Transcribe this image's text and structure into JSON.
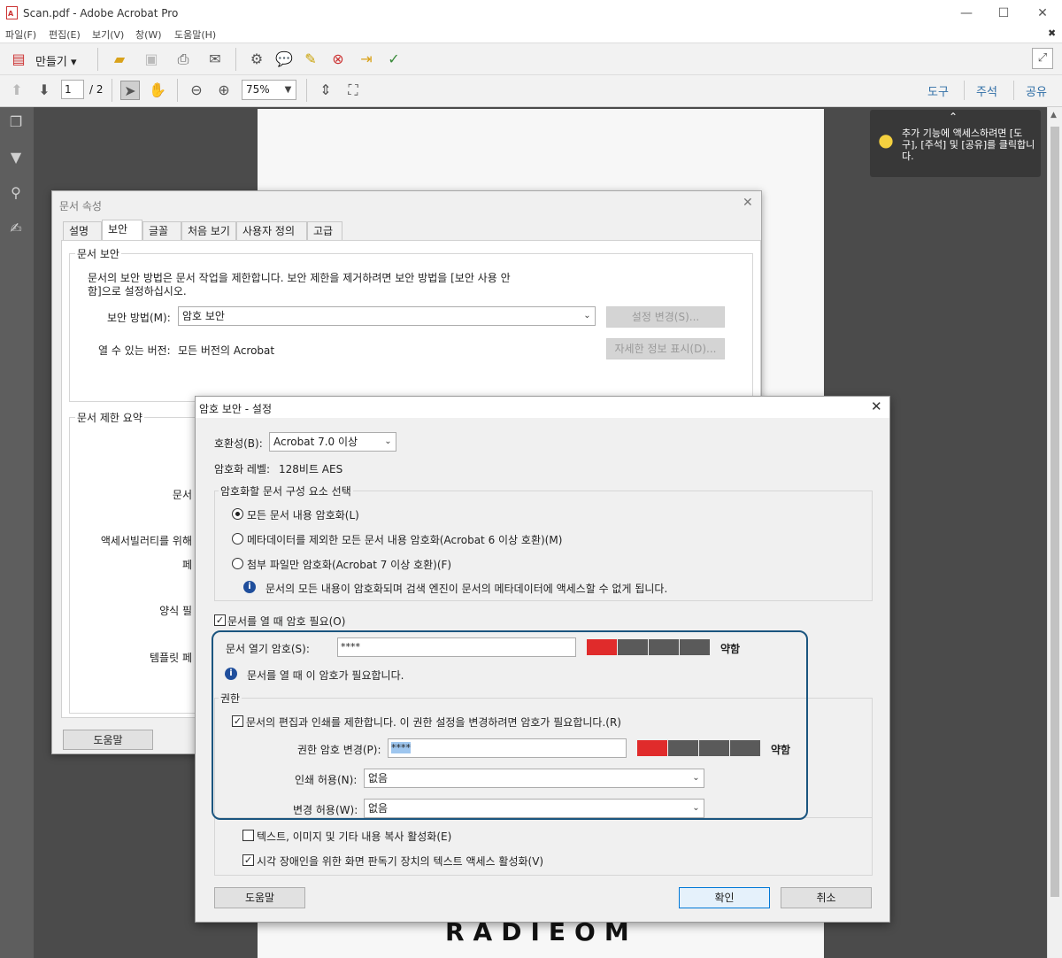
{
  "window": {
    "title": "Scan.pdf - Adobe Acrobat Pro",
    "minimize": "—",
    "maximize": "☐",
    "close": "✕"
  },
  "menu": [
    "파일(F)",
    "편집(E)",
    "보기(V)",
    "창(W)",
    "도움말(H)"
  ],
  "toolbar": {
    "create_label": "만들기 ▾"
  },
  "nav": {
    "page_current": "1",
    "page_total": "/ 2",
    "zoom": "75%"
  },
  "right_links": [
    "도구",
    "주석",
    "공유"
  ],
  "tooltip": {
    "text": "추가 기능에 액세스하려면 [도구], [주석] 및 [공유]를 클릭합니다."
  },
  "props": {
    "title": "문서 속성",
    "tabs": [
      "설명",
      "보안",
      "글꼴",
      "처음 보기",
      "사용자 정의",
      "고급"
    ],
    "security_group": "문서 보안",
    "desc_line1": "문서의 보안 방법은 문서 작업을 제한합니다. 보안 제한을 제거하려면 보안 방법을 [보안 사용 안",
    "desc_line2": "함]으로 설정하십시오.",
    "method_label": "보안 방법(M):",
    "method_value": "암호 보안",
    "change_btn": "설정 변경(S)...",
    "version_label": "열 수 있는 버전:",
    "version_value": "모든 버전의 Acrobat",
    "details_btn": "자세한 정보 표시(D)...",
    "summary_group": "문서 제한 요약",
    "summary_fragments": [
      "",
      "문서",
      "액세서빌러티를 위해",
      "페",
      "",
      "양식 필",
      "",
      "템플릿 페"
    ],
    "help_btn": "도움말"
  },
  "pw": {
    "title": "암호 보안 - 설정",
    "compat_label": "호환성(B):",
    "compat_value": "Acrobat 7.0 이상",
    "enc_label": "암호화 레벨:",
    "enc_value": "128비트 AES",
    "select_group": "암호화할 문서 구성 요소 선택",
    "radio1": "모든 문서 내용 암호화(L)",
    "radio2": "메타데이터를 제외한 모든 문서 내용 암호화(Acrobat 6 이상 호환)(M)",
    "radio3": "첨부 파일만 암호화(Acrobat 7 이상 호환)(F)",
    "info1": "문서의 모든 내용이 암호화되며 검색 엔진이 문서의 메타데이터에 액세스할 수 없게 됩니다.",
    "require_open": "문서를 열 때 암호 필요(O)",
    "open_pw_label": "문서 열기 암호(S):",
    "open_pw_value": "****",
    "strength1": "약함",
    "info2": "문서를 열 때 이 암호가 필요합니다.",
    "perm_group": "권한",
    "restrict": "문서의 편집과 인쇄를 제한합니다. 이 권한 설정을 변경하려면 암호가 필요합니다.(R)",
    "perm_pw_label": "권한 암호 변경(P):",
    "perm_pw_value": "****",
    "strength2": "약함",
    "print_label": "인쇄 허용(N):",
    "print_value": "없음",
    "change_label": "변경 허용(W):",
    "change_value": "없음",
    "copy_chk": "텍스트, 이미지 및 기타 내용 복사 활성화(E)",
    "screen_chk": "시각 장애인을 위한 화면 판독기 장치의 텍스트 액세스 활성화(V)",
    "help_btn": "도움말",
    "ok_btn": "확인",
    "cancel_btn": "취소"
  },
  "colors": {
    "meter_red": "#e02b2b",
    "meter_gray": "#5a5a5a",
    "highlight": "#1b557f",
    "link": "#2f6ea6"
  },
  "watermark": "RADIEOM"
}
